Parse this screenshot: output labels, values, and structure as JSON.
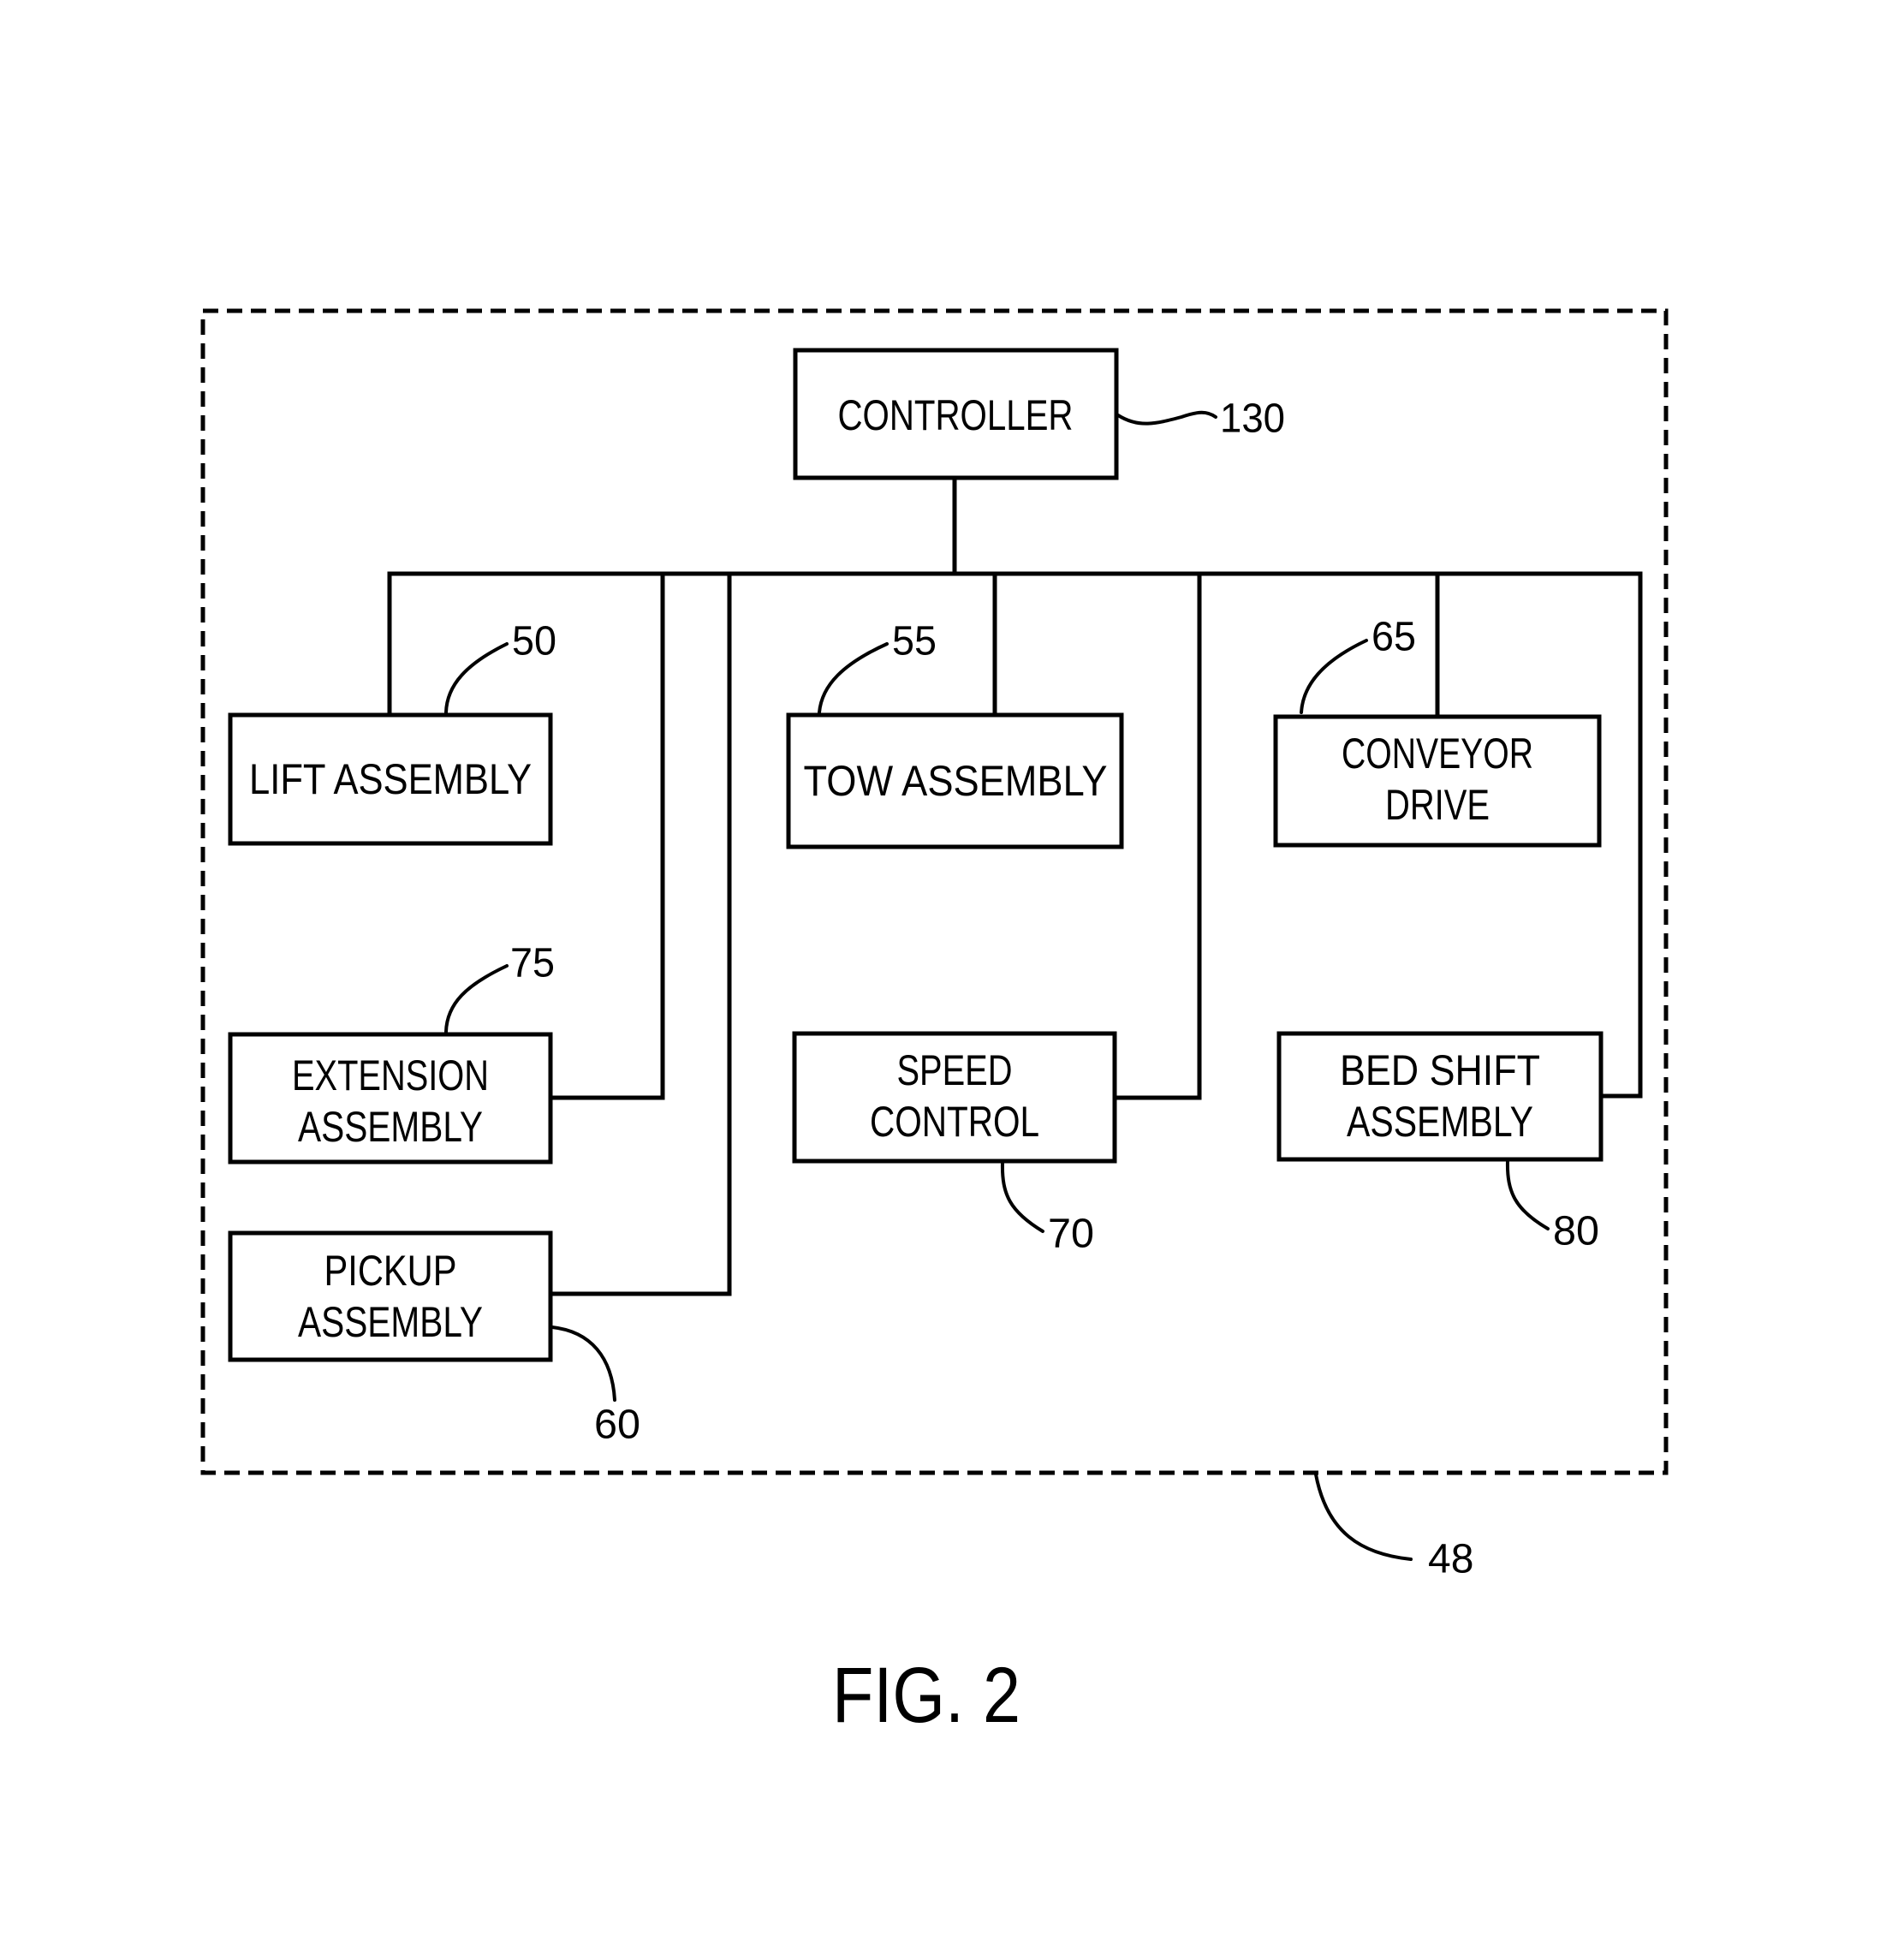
{
  "figure": {
    "caption": "FIG. 2",
    "system": {
      "ref": "48"
    },
    "controller": {
      "lines": [
        "CONTROLLER"
      ],
      "ref": "130"
    },
    "components": [
      {
        "id": "lift",
        "lines": [
          "LIFT  ASSEMBLY"
        ],
        "ref": "50"
      },
      {
        "id": "tow",
        "lines": [
          "TOW   ASSEMBLY"
        ],
        "ref": "55"
      },
      {
        "id": "conveyor",
        "lines": [
          "CONVEYOR",
          "DRIVE"
        ],
        "ref": "65"
      },
      {
        "id": "extension",
        "lines": [
          "EXTENSION",
          "ASSEMBLY"
        ],
        "ref": "75"
      },
      {
        "id": "speed",
        "lines": [
          "SPEED",
          "CONTROL"
        ],
        "ref": "70"
      },
      {
        "id": "bedshift",
        "lines": [
          "BED  SHIFT",
          "ASSEMBLY"
        ],
        "ref": "80"
      },
      {
        "id": "pickup",
        "lines": [
          "PICKUP",
          "ASSEMBLY"
        ],
        "ref": "60"
      }
    ]
  }
}
